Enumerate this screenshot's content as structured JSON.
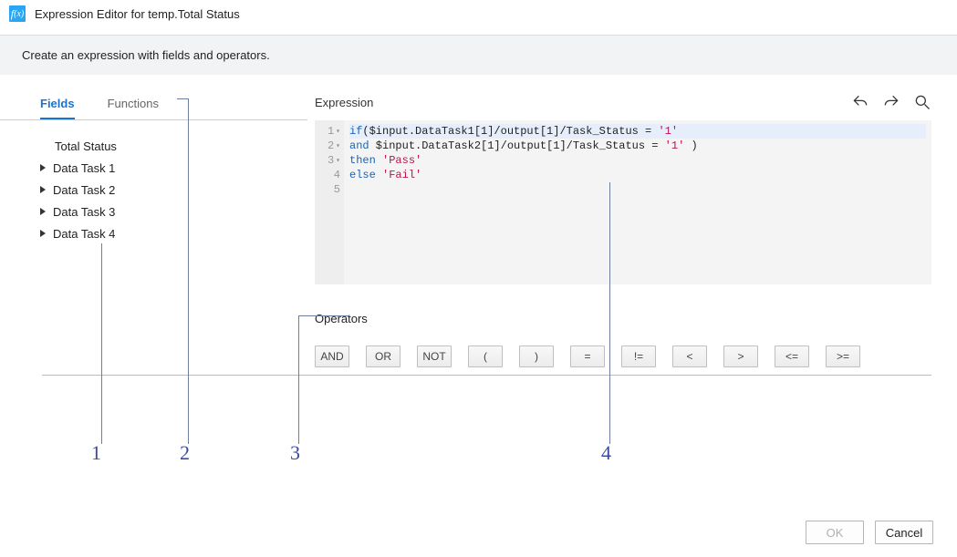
{
  "window": {
    "title": "Expression Editor for temp.Total Status",
    "subtitle": "Create an expression with fields and operators."
  },
  "left": {
    "tabs": {
      "fields": "Fields",
      "functions": "Functions"
    },
    "items": [
      {
        "label": "Total Status",
        "hasChildren": false
      },
      {
        "label": "Data Task 1",
        "hasChildren": true
      },
      {
        "label": "Data Task 2",
        "hasChildren": true
      },
      {
        "label": "Data Task 3",
        "hasChildren": true
      },
      {
        "label": "Data Task 4",
        "hasChildren": true
      }
    ]
  },
  "editor": {
    "title": "Expression",
    "lines": {
      "l1": {
        "kw": "if",
        "body": "($input.DataTask1[1]/output[1]/Task_Status = ",
        "str": "'1'"
      },
      "l2": {
        "kw": "and",
        "body": " $input.DataTask2[1]/output[1]/Task_Status = ",
        "str": "'1'",
        "tail": " )"
      },
      "l3": {
        "kw": "then",
        "sp": " ",
        "str": "'Pass'"
      },
      "l4": {
        "kw": "else",
        "sp": " ",
        "str": "'Fail'"
      }
    }
  },
  "operators": {
    "title": "Operators",
    "items": [
      "AND",
      "OR",
      "NOT",
      "(",
      ")",
      "=",
      "!=",
      "<",
      ">",
      "<=",
      ">="
    ]
  },
  "annotations": {
    "a1": "1",
    "a2": "2",
    "a3": "3",
    "a4": "4"
  },
  "footer": {
    "ok": "OK",
    "cancel": "Cancel"
  }
}
